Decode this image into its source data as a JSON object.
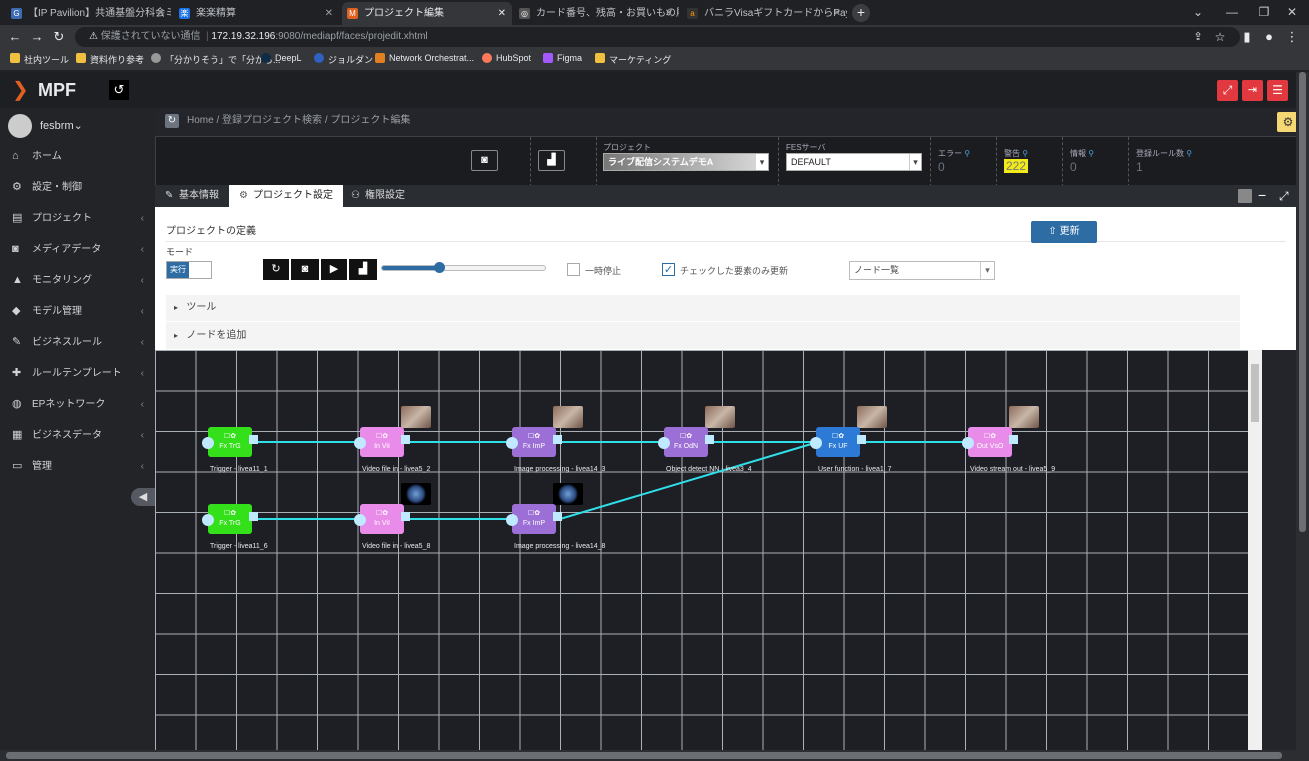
{
  "browser": {
    "tabs": [
      {
        "label": "【IP Pavilion】共通基盤分科会ミーテ",
        "icon": "G",
        "color": "#3d6bb3"
      },
      {
        "label": "楽楽精算",
        "icon": "楽",
        "color": "#1a73e8"
      },
      {
        "label": "プロジェクト編集",
        "icon": "M",
        "color": "#e06020"
      },
      {
        "label": "カード番号、残高・お買いもの履歴を",
        "icon": "◎",
        "color": "#666"
      },
      {
        "label": "バニラVisaギフトカードからPayPayにチ",
        "icon": "a",
        "color": "#333"
      }
    ],
    "security_text": "保護されていない通信",
    "url_host": "172.19.32.196",
    "url_rest": ":9080/mediapf/faces/projedit.xhtml",
    "bookmarks": [
      {
        "label": "社内ツール",
        "color": "#f0c040"
      },
      {
        "label": "資料作り参考",
        "color": "#f0c040"
      },
      {
        "label": "「分かりそう」で「分から...",
        "color": "#999"
      },
      {
        "label": "DeepL",
        "color": "#0f2b46"
      },
      {
        "label": "ジョルダン",
        "color": "#3060c0"
      },
      {
        "label": "Network Orchestrat...",
        "color": "#e08020"
      },
      {
        "label": "HubSpot",
        "color": "#ff7a59"
      },
      {
        "label": "Figma",
        "color": "#a259ff"
      },
      {
        "label": "マーケティング",
        "color": "#f0c040"
      }
    ]
  },
  "app": {
    "logo": "MPF",
    "username": "fesbrm",
    "nav": [
      {
        "label": "ホーム",
        "icon": "home-icon",
        "glyph": "⌂",
        "chevron": false
      },
      {
        "label": "設定・制御",
        "icon": "gear-icon",
        "glyph": "⚙",
        "chevron": false
      },
      {
        "label": "プロジェクト",
        "icon": "file-icon",
        "glyph": "▤",
        "chevron": true
      },
      {
        "label": "メディアデータ",
        "icon": "camera-icon",
        "glyph": "◙",
        "chevron": true
      },
      {
        "label": "モニタリング",
        "icon": "chart-icon",
        "glyph": "▲",
        "chevron": true
      },
      {
        "label": "モデル管理",
        "icon": "graduation-cap-icon",
        "glyph": "◆",
        "chevron": true
      },
      {
        "label": "ビジネスルール",
        "icon": "edit-icon",
        "glyph": "✎",
        "chevron": true
      },
      {
        "label": "ルールテンプレート",
        "icon": "puzzle-icon",
        "glyph": "✚",
        "chevron": true
      },
      {
        "label": "EPネットワーク",
        "icon": "globe-icon",
        "glyph": "◍",
        "chevron": true
      },
      {
        "label": "ビジネスデータ",
        "icon": "table-icon",
        "glyph": "▦",
        "chevron": true
      },
      {
        "label": "管理",
        "icon": "monitor-icon",
        "glyph": "▭",
        "chevron": true
      }
    ],
    "breadcrumb": {
      "home": "Home",
      "sep": "/",
      "search": "登録プロジェクト検索",
      "current": "プロジェクト編集"
    },
    "info": {
      "project_label": "プロジェクト",
      "project_value": "ライブ配信システムデモA",
      "server_label": "FESサーバ",
      "server_value": "DEFAULT",
      "error_label": "エラー",
      "error_value": "0",
      "warning_label": "警告",
      "warning_value": "222",
      "info_label": "情報",
      "info_value": "0",
      "rules_label": "登録ルール数",
      "rules_value": "1"
    },
    "tabs": {
      "basic": "基本情報",
      "project": "プロジェクト設定",
      "permission": "権限設定"
    },
    "panel": {
      "title": "プロジェクトの定義",
      "update_button": "更新",
      "mode_label": "モード",
      "mode_value": "実行",
      "pause_label": "一時停止",
      "checked_only_label": "チェックした要素のみ更新",
      "node_select": "ノード一覧",
      "tools": "ツール",
      "add_node": "ノードを追加",
      "slider_value": 0.35
    },
    "graph": {
      "nodes": [
        {
          "code": "Fx TrG",
          "caption": "Trigger - livea11_1",
          "color": "#33e01a"
        },
        {
          "code": "In ViI",
          "caption": "Video file in - livea5_2",
          "color": "#e98be8"
        },
        {
          "code": "Fx ImP",
          "caption": "Image processing - livea14_3",
          "color": "#9b6fd6"
        },
        {
          "code": "Fx OdN",
          "caption": "Object detect NN - livea3_4",
          "color": "#9b6fd6"
        },
        {
          "code": "Fx UF",
          "caption": "User function - livea1_7",
          "color": "#2d79d6"
        },
        {
          "code": "Out VsO",
          "caption": "Video stream out - livea5_9",
          "color": "#e98be8"
        },
        {
          "code": "Fx TrG",
          "caption": "Trigger - livea11_6",
          "color": "#33e01a"
        },
        {
          "code": "In ViI",
          "caption": "Video file in - livea5_8",
          "color": "#e98be8"
        },
        {
          "code": "Fx ImP",
          "caption": "Image processing - livea14_8",
          "color": "#9b6fd6"
        }
      ]
    }
  }
}
